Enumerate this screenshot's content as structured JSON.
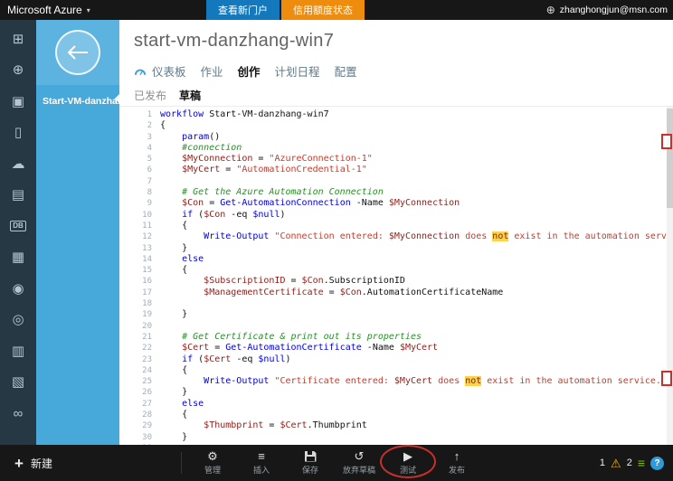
{
  "topbar": {
    "brand": "Microsoft Azure",
    "chevron_icon": "▾",
    "buttons": [
      {
        "name": "view-new-portal-button",
        "label": "查看新门户",
        "color": "#1478bd"
      },
      {
        "name": "credit-status-button",
        "label": "信用额度状态",
        "color": "#ee8c0e"
      }
    ],
    "globe_icon": "⊕",
    "account": "zhanghongjun@msn.com"
  },
  "sidebar": {
    "items": [
      {
        "name": "all-items-icon",
        "glyph": "⊞"
      },
      {
        "name": "web-sites-icon",
        "glyph": "⊕"
      },
      {
        "name": "virtual-machines-icon",
        "glyph": "▣"
      },
      {
        "name": "mobile-services-icon",
        "glyph": "▯"
      },
      {
        "name": "cloud-services-icon",
        "glyph": "☁"
      },
      {
        "name": "batch-services-icon",
        "glyph": "▤"
      },
      {
        "name": "sql-database-icon",
        "glyph": "DB"
      },
      {
        "name": "storage-icon",
        "glyph": "▦"
      },
      {
        "name": "media-services-icon",
        "glyph": "◉"
      },
      {
        "name": "service-bus-icon",
        "glyph": "◎"
      },
      {
        "name": "scheduler-icon",
        "glyph": "▥"
      },
      {
        "name": "bi-icon",
        "glyph": "▧"
      },
      {
        "name": "visual-studio-icon",
        "glyph": "∞"
      }
    ]
  },
  "nav_panel": {
    "runbook_name": "Start-VM-danzha..."
  },
  "page": {
    "title": "start-vm-danzhang-win7",
    "tabs": [
      {
        "name": "tab-dashboard",
        "label": "仪表板",
        "active": false
      },
      {
        "name": "tab-jobs",
        "label": "作业",
        "active": false
      },
      {
        "name": "tab-author",
        "label": "创作",
        "active": true
      },
      {
        "name": "tab-schedule",
        "label": "计划日程",
        "active": false
      },
      {
        "name": "tab-configure",
        "label": "配置",
        "active": false
      }
    ],
    "subtabs": [
      {
        "name": "subtab-published",
        "label": "已发布",
        "active": false
      },
      {
        "name": "subtab-draft",
        "label": "草稿",
        "active": true
      }
    ]
  },
  "editor": {
    "lines": [
      {
        "n": 1,
        "seg": [
          [
            "k",
            "workflow"
          ],
          [
            "o",
            " Start-VM-danzhang-win7"
          ]
        ]
      },
      {
        "n": 2,
        "seg": [
          [
            "o",
            "{"
          ]
        ]
      },
      {
        "n": 3,
        "seg": [
          [
            "o",
            "    "
          ],
          [
            "k",
            "param"
          ],
          [
            "o",
            "()"
          ]
        ]
      },
      {
        "n": 4,
        "seg": [
          [
            "c",
            "    #connection"
          ]
        ]
      },
      {
        "n": 5,
        "seg": [
          [
            "o",
            "    "
          ],
          [
            "v",
            "$MyConnection"
          ],
          [
            "o",
            " = "
          ],
          [
            "s",
            "\"AzureConnection-1\""
          ]
        ]
      },
      {
        "n": 6,
        "seg": [
          [
            "o",
            "    "
          ],
          [
            "v",
            "$MyCert"
          ],
          [
            "o",
            " = "
          ],
          [
            "s",
            "\"AutomationCredential-1\""
          ]
        ]
      },
      {
        "n": 7,
        "seg": []
      },
      {
        "n": 8,
        "seg": [
          [
            "c",
            "    # Get the Azure Automation Connection"
          ]
        ]
      },
      {
        "n": 9,
        "seg": [
          [
            "o",
            "    "
          ],
          [
            "v",
            "$Con"
          ],
          [
            "o",
            " = "
          ],
          [
            "m",
            "Get-AutomationConnection"
          ],
          [
            "o",
            " -Name "
          ],
          [
            "v",
            "$MyConnection"
          ]
        ]
      },
      {
        "n": 10,
        "seg": [
          [
            "o",
            "    "
          ],
          [
            "k",
            "if"
          ],
          [
            "o",
            " ("
          ],
          [
            "v",
            "$Con"
          ],
          [
            "o",
            " -eq "
          ],
          [
            "k",
            "$null"
          ],
          [
            "o",
            ")"
          ]
        ]
      },
      {
        "n": 11,
        "seg": [
          [
            "o",
            "    {"
          ]
        ]
      },
      {
        "n": 12,
        "seg": [
          [
            "o",
            "        "
          ],
          [
            "m",
            "Write-Output"
          ],
          [
            "o",
            " "
          ],
          [
            "s",
            "\"Connection entered: "
          ],
          [
            "v",
            "$MyConnection"
          ],
          [
            "s",
            " does "
          ],
          [
            "hl",
            "not"
          ],
          [
            "s",
            " exist in the automation service. Please crea"
          ]
        ]
      },
      {
        "n": 13,
        "seg": [
          [
            "o",
            "    }"
          ]
        ]
      },
      {
        "n": 14,
        "seg": [
          [
            "o",
            "    "
          ],
          [
            "k",
            "else"
          ]
        ]
      },
      {
        "n": 15,
        "seg": [
          [
            "o",
            "    {"
          ]
        ]
      },
      {
        "n": 16,
        "seg": [
          [
            "o",
            "        "
          ],
          [
            "v",
            "$SubscriptionID"
          ],
          [
            "o",
            " = "
          ],
          [
            "v",
            "$Con"
          ],
          [
            "o",
            ".SubscriptionID"
          ]
        ]
      },
      {
        "n": 17,
        "seg": [
          [
            "o",
            "        "
          ],
          [
            "v",
            "$ManagementCertificate"
          ],
          [
            "o",
            " = "
          ],
          [
            "v",
            "$Con"
          ],
          [
            "o",
            ".AutomationCertificateName"
          ]
        ]
      },
      {
        "n": 18,
        "seg": []
      },
      {
        "n": 19,
        "seg": [
          [
            "o",
            "    }"
          ]
        ]
      },
      {
        "n": 20,
        "seg": []
      },
      {
        "n": 21,
        "seg": [
          [
            "c",
            "    # Get Certificate & print out its properties"
          ]
        ]
      },
      {
        "n": 22,
        "seg": [
          [
            "o",
            "    "
          ],
          [
            "v",
            "$Cert"
          ],
          [
            "o",
            " = "
          ],
          [
            "m",
            "Get-AutomationCertificate"
          ],
          [
            "o",
            " -Name "
          ],
          [
            "v",
            "$MyCert"
          ]
        ]
      },
      {
        "n": 23,
        "seg": [
          [
            "o",
            "    "
          ],
          [
            "k",
            "if"
          ],
          [
            "o",
            " ("
          ],
          [
            "v",
            "$Cert"
          ],
          [
            "o",
            " -eq "
          ],
          [
            "k",
            "$null"
          ],
          [
            "o",
            ")"
          ]
        ]
      },
      {
        "n": 24,
        "seg": [
          [
            "o",
            "    {"
          ]
        ]
      },
      {
        "n": 25,
        "seg": [
          [
            "o",
            "        "
          ],
          [
            "m",
            "Write-Output"
          ],
          [
            "o",
            " "
          ],
          [
            "s",
            "\"Certificate entered: "
          ],
          [
            "v",
            "$MyCert"
          ],
          [
            "s",
            " does "
          ],
          [
            "hl",
            "not"
          ],
          [
            "s",
            " exist in the automation service. Please create on"
          ]
        ]
      },
      {
        "n": 26,
        "seg": [
          [
            "o",
            "    }"
          ]
        ]
      },
      {
        "n": 27,
        "seg": [
          [
            "o",
            "    "
          ],
          [
            "k",
            "else"
          ]
        ]
      },
      {
        "n": 28,
        "seg": [
          [
            "o",
            "    {"
          ]
        ]
      },
      {
        "n": 29,
        "seg": [
          [
            "o",
            "        "
          ],
          [
            "v",
            "$Thumbprint"
          ],
          [
            "o",
            " = "
          ],
          [
            "v",
            "$Cert"
          ],
          [
            "o",
            ".Thumbprint"
          ]
        ]
      },
      {
        "n": 30,
        "seg": [
          [
            "o",
            "    }"
          ]
        ]
      },
      {
        "n": 31,
        "seg": []
      }
    ]
  },
  "bottombar": {
    "plus_icon": "+",
    "new_label": "新建",
    "commands": [
      {
        "name": "manage-command",
        "icon": "wrench-icon",
        "glyph": "⚙",
        "label": "管理",
        "floppy": false
      },
      {
        "name": "insert-command",
        "icon": "insert-lines-icon",
        "glyph": "≡",
        "label": "插入",
        "floppy": false
      },
      {
        "name": "save-command",
        "icon": "save-floppy-icon",
        "glyph": "",
        "label": "保存",
        "floppy": true
      },
      {
        "name": "discard-draft-command",
        "icon": "undo-arrow-icon",
        "glyph": "↺",
        "label": "放弃草稿",
        "floppy": false
      },
      {
        "name": "test-command",
        "icon": "play-icon",
        "glyph": "▶",
        "label": "测试",
        "floppy": false
      },
      {
        "name": "publish-command",
        "icon": "publish-arrow-icon",
        "glyph": "↑",
        "label": "发布",
        "floppy": false
      }
    ],
    "status": {
      "warning_count": "1",
      "warning_icon": "⚠",
      "info_count": "2",
      "info_icon": "≡",
      "help_label": "?"
    }
  },
  "colors": {
    "accent_blue": "#47a8da",
    "button_blue": "#1478bd",
    "button_orange": "#ee8c0e",
    "warning_yellow": "#f7b61c",
    "info_green": "#7fba00",
    "annotation_red": "#c9302c"
  }
}
